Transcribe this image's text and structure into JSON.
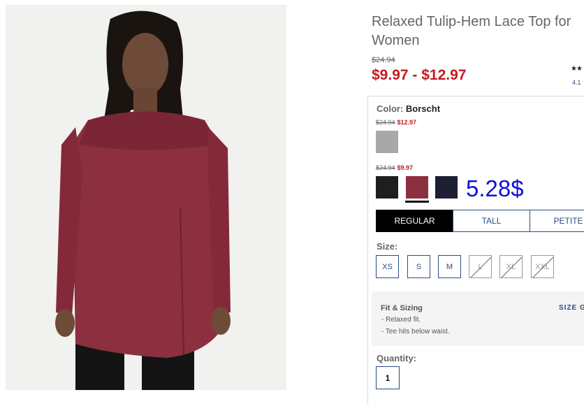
{
  "product": {
    "title": "Relaxed Tulip-Hem Lace Top for Women",
    "original_price": "$24.94",
    "sale_range": "$9.97 - $12.97",
    "rating_stars": "★★",
    "rating_value": "4.1"
  },
  "color": {
    "label": "Color:",
    "selected": "Borscht",
    "groups": [
      {
        "was": "$24.94",
        "now": "$12.97",
        "swatches": [
          {
            "name": "heather gray",
            "color": "#a8a8a8"
          }
        ]
      },
      {
        "was": "$24.94",
        "now": "$9.97",
        "swatches": [
          {
            "name": "black",
            "color": "#1e1e1e"
          },
          {
            "name": "borscht",
            "color": "#8c2f3f",
            "selected": true
          },
          {
            "name": "navy",
            "color": "#1d1f33"
          }
        ]
      }
    ]
  },
  "annotation": "5.28$",
  "fit_tabs": [
    {
      "label": "REGULAR",
      "active": true
    },
    {
      "label": "TALL",
      "active": false
    },
    {
      "label": "PETITE",
      "active": false
    }
  ],
  "size": {
    "label": "Size:",
    "options": [
      {
        "label": "XS",
        "available": true
      },
      {
        "label": "S",
        "available": true
      },
      {
        "label": "M",
        "available": true
      },
      {
        "label": "L",
        "available": false
      },
      {
        "label": "XL",
        "available": false
      },
      {
        "label": "XXL",
        "available": false
      }
    ]
  },
  "fit_sizing": {
    "title": "Fit & Sizing",
    "size_guide": "SIZE GI",
    "bullets": [
      "-  Relaxed fit.",
      "-  Tee hits below waist."
    ]
  },
  "quantity": {
    "label": "Quantity:",
    "value": "1"
  },
  "colors": {
    "sale_red": "#c41a1f",
    "link_blue": "#2a4d83",
    "annotation_blue": "#1010d8",
    "top_color": "#8c2f3f"
  }
}
